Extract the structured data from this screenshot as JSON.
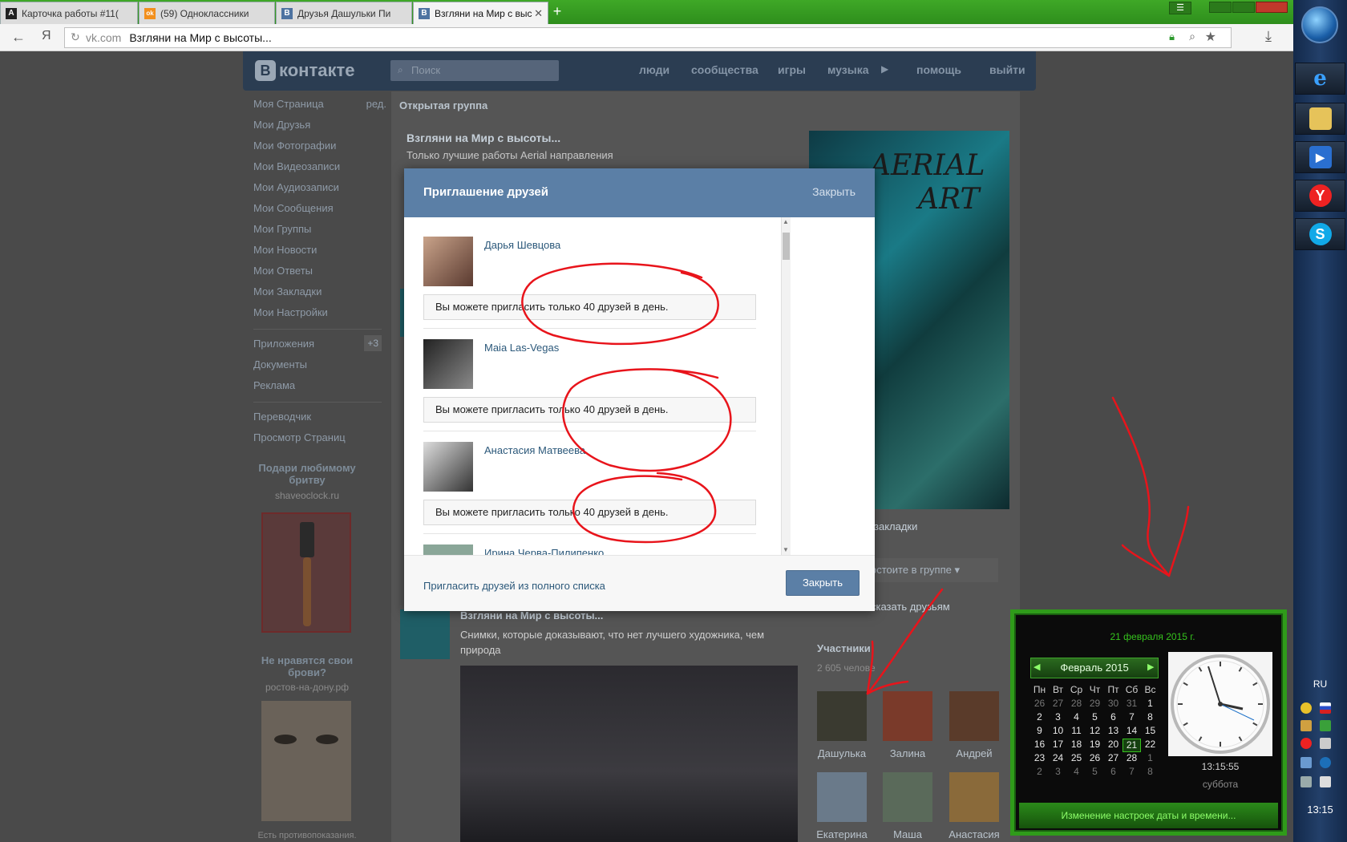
{
  "browser": {
    "tabs": [
      {
        "label": "Карточка работы #11(",
        "fav": "А",
        "fav_color": "#222222"
      },
      {
        "label": "(59) Одноклассники",
        "fav": "ok",
        "fav_color": "#f28f1c"
      },
      {
        "label": "Друзья Дашульки Пи",
        "fav": "В",
        "fav_color": "#4d73a1"
      },
      {
        "label": "Взгляни на Мир с выс",
        "fav": "В",
        "fav_color": "#4d73a1"
      }
    ],
    "address_host": "vk.com",
    "address_title": "Взгляни на Мир с высоты...",
    "yandex_icon": "Я"
  },
  "vk": {
    "logo": "контакте",
    "logo_badge": "В",
    "search_placeholder": "Поиск",
    "topnav": [
      "люди",
      "сообщества",
      "игры",
      "музыка",
      "помощь",
      "выйти"
    ],
    "leftnav": {
      "main": [
        "Моя Страница",
        "Мои Друзья",
        "Мои Фотографии",
        "Мои Видеозаписи",
        "Мои Аудиозаписи",
        "Мои Сообщения",
        "Мои Группы",
        "Мои Новости",
        "Мои Ответы",
        "Мои Закладки",
        "Мои Настройки"
      ],
      "edit": "ред.",
      "secondary": [
        "Приложения",
        "Документы",
        "Реклама"
      ],
      "apps_badge": "+3",
      "tertiary": [
        "Переводчик",
        "Просмотр Страниц"
      ]
    },
    "ads": [
      {
        "title": "Подари любимому бритву",
        "site": "shaveoclock.ru"
      },
      {
        "title": "Не нравятся свои брови?",
        "site": "ростов-на-дону.рф",
        "note": "Есть противопоказания."
      }
    ],
    "group": {
      "header": "Открытая группа",
      "name": "Взгляни на Мир с высоты...",
      "desc": "Только лучшие работы Aerial направления",
      "cover_title_1": "AERIAL",
      "cover_title_2": "ART",
      "bookmarks": "закладки",
      "member_btn": "остоите в группе",
      "tell_friends": "сказать друзьям",
      "members_header": "Участники",
      "members_count": "2 605 челове",
      "members": [
        "Дашулька",
        "Залина",
        "Андрей",
        "Екатерина",
        "Маша",
        "Анастасия"
      ]
    },
    "post": {
      "title": "Взгляни на Мир с высоты...",
      "text": "Снимки, которые доказывают, что нет лучшего художника, чем природа"
    }
  },
  "modal": {
    "title": "Приглашение друзей",
    "close_link": "Закрыть",
    "friends": [
      {
        "name": "Дарья Шевцова",
        "limit": "Вы можете пригласить только 40 друзей в день."
      },
      {
        "name": "Maia Las-Vegas",
        "limit": "Вы можете пригласить только 40 друзей в день."
      },
      {
        "name": "Анастасия Матвеева",
        "limit": "Вы можете пригласить только 40 друзей в день."
      },
      {
        "name": "Ирина Черва-Пилипенко",
        "limit": ""
      }
    ],
    "invite_all": "Пригласить друзей из полного списка",
    "close_btn": "Закрыть"
  },
  "taskbar": {
    "lang": "RU",
    "time": "13:15"
  },
  "calendar": {
    "date_long": "21 февраля 2015 г.",
    "month": "Февраль 2015",
    "weekdays": [
      "Пн",
      "Вт",
      "Ср",
      "Чт",
      "Пт",
      "Сб",
      "Вс"
    ],
    "weeks": [
      [
        "26",
        "27",
        "28",
        "29",
        "30",
        "31",
        "1"
      ],
      [
        "2",
        "3",
        "4",
        "5",
        "6",
        "7",
        "8"
      ],
      [
        "9",
        "10",
        "11",
        "12",
        "13",
        "14",
        "15"
      ],
      [
        "16",
        "17",
        "18",
        "19",
        "20",
        "21",
        "22"
      ],
      [
        "23",
        "24",
        "25",
        "26",
        "27",
        "28",
        "1"
      ],
      [
        "2",
        "3",
        "4",
        "5",
        "6",
        "7",
        "8"
      ]
    ],
    "today": "21",
    "time": "13:15:55",
    "weekday": "суббота",
    "footer_link": "Изменение настроек даты и времени..."
  },
  "colors": {
    "vk_blue": "#5b7fa6",
    "vk_link": "#2b587a",
    "gadget_green": "#35c21d",
    "annotation_red": "#e8141b"
  }
}
